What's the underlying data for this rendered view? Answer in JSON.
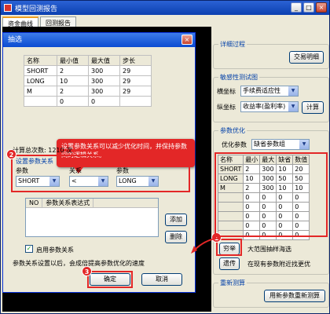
{
  "window": {
    "title": "模型回测报告"
  },
  "tabs": [
    "资金曲线",
    "回测报告"
  ],
  "right": {
    "details_group": "详细过程",
    "trade_btn": "交易明细",
    "sens_group": "敏感性测试图",
    "x_label": "横坐标",
    "x_value": "手续费适应性",
    "y_label": "纵坐标",
    "y_value": "收益率(盈利率)",
    "calc_btn": "计算",
    "opt_group": "参数优化",
    "opt_label": "优化参数",
    "opt_value": "缺省参数组",
    "table_headers": [
      "名称",
      "最小",
      "最大",
      "缺省",
      "数值"
    ],
    "table_rows": [
      [
        "SHORT",
        "2",
        "300",
        "10",
        "20"
      ],
      [
        "LONG",
        "10",
        "300",
        "50",
        "50"
      ],
      [
        "M",
        "2",
        "300",
        "10",
        "10"
      ],
      [
        "",
        "0",
        "0",
        "0",
        "0"
      ],
      [
        "",
        "0",
        "0",
        "0",
        "0"
      ],
      [
        "",
        "0",
        "0",
        "0",
        "0"
      ],
      [
        "",
        "0",
        "0",
        "0",
        "0"
      ],
      [
        "",
        "0",
        "0",
        "0",
        "0"
      ]
    ],
    "exhaustive_btn": "穷举",
    "exhaustive_desc": "大范围抽样海选",
    "genetic_btn": "遗传",
    "genetic_desc": "在现有参数附近找更优",
    "retest_group": "重新测算",
    "retest_btn": "用新参数重新测算"
  },
  "dialog": {
    "title": "抽选",
    "close": "×",
    "range_headers": [
      "名称",
      "最小值",
      "最大值",
      "步长"
    ],
    "range_rows": [
      [
        "SHORT",
        "2",
        "300",
        "29"
      ],
      [
        "LONG",
        "10",
        "300",
        "29"
      ],
      [
        "M",
        "2",
        "300",
        "29"
      ],
      [
        "",
        "0",
        "0",
        ""
      ]
    ],
    "calc_count": "计算总次数: 1210 次",
    "callout": "设置参数关系可以减少优化时间，并保持参数间的逻辑关系。",
    "rel_title": "设置参数关系",
    "param_label": "参数",
    "relation_label": "关系",
    "param2_label": "参数",
    "param1_value": "SHORT",
    "relation_value": "<",
    "param2_value": "LONG",
    "list_headers": [
      "NO",
      "参数关系表达式"
    ],
    "add_btn": "添加",
    "delete_btn": "删除",
    "enable_label": "启用参数关系",
    "hint": "参数关系设置以后，会成倍提高参数优化的速度",
    "ok_btn": "确定",
    "cancel_btn": "取消"
  },
  "badges": [
    "1",
    "2",
    "3"
  ]
}
